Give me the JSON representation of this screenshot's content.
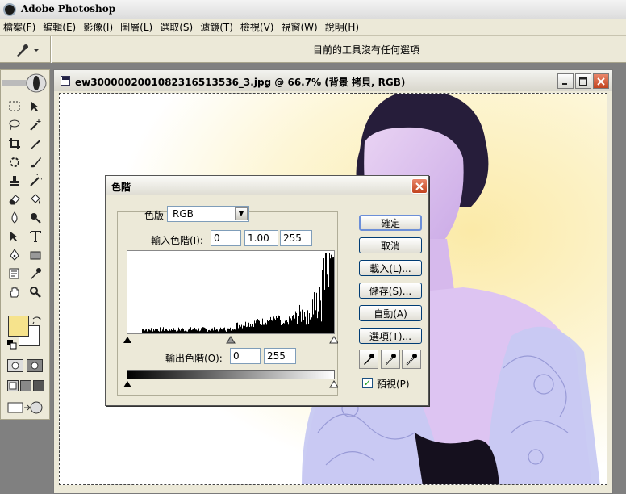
{
  "app": {
    "title": "Adobe Photoshop",
    "menus": [
      "檔案(F)",
      "編輯(E)",
      "影像(I)",
      "圖層(L)",
      "選取(S)",
      "濾鏡(T)",
      "檢視(V)",
      "視窗(W)",
      "說明(H)"
    ],
    "options_bar_text": "目前的工具沒有任何選項",
    "foreground_color": "#f6e38c",
    "background_color": "#ffffff"
  },
  "document": {
    "title": "ew3000002001082316513536_3.jpg @ 66.7% (背景 拷貝, RGB)"
  },
  "levels_dialog": {
    "title": "色階",
    "channel_label": "色版",
    "channel_value": "RGB",
    "input_levels_label": "輸入色階(I):",
    "input_black": "0",
    "input_gamma": "1.00",
    "input_white": "255",
    "output_levels_label": "輸出色階(O):",
    "output_black": "0",
    "output_white": "255",
    "buttons": {
      "ok": "確定",
      "cancel": "取消",
      "load": "載入(L)...",
      "save": "儲存(S)...",
      "auto": "自動(A)",
      "options": "選項(T)..."
    },
    "preview_label": "預視(P)",
    "preview_checked": true
  }
}
